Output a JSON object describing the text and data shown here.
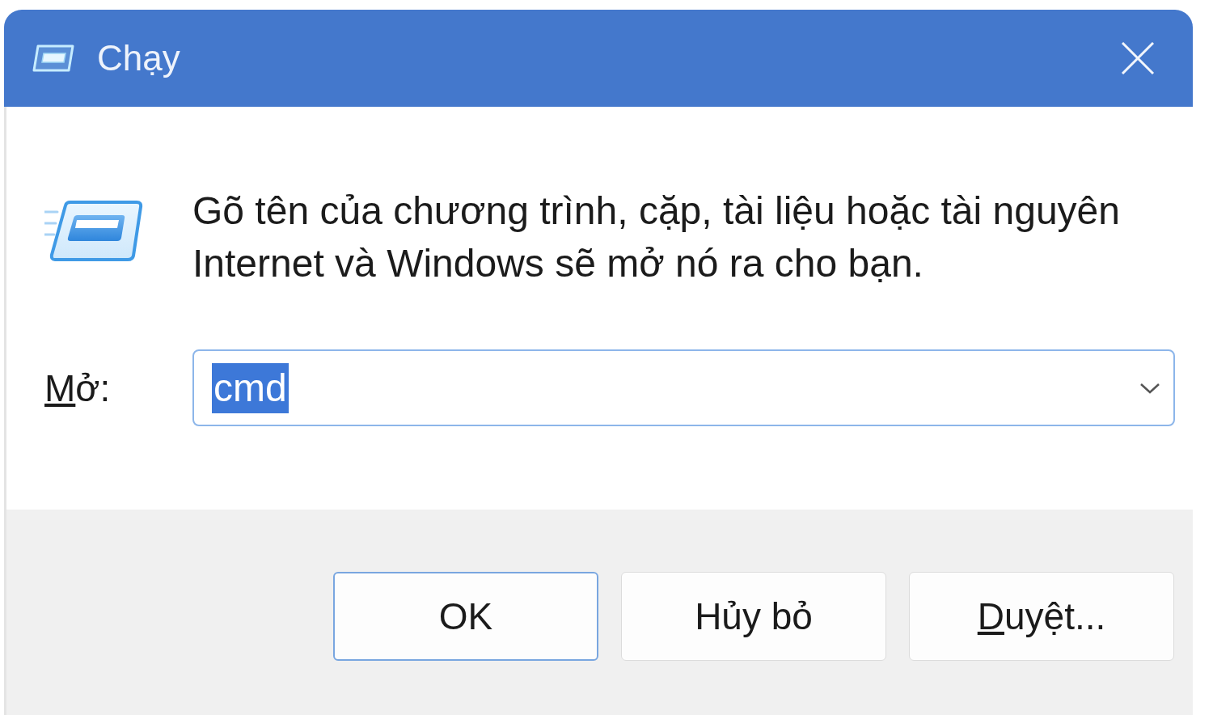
{
  "window": {
    "title": "Chạy"
  },
  "message": "Gõ tên của chương trình, cặp, tài liệu hoặc tài nguyên Internet và Windows sẽ mở nó ra cho bạn.",
  "open_field": {
    "label": "Mở:",
    "label_mnemonic": true,
    "value": "cmd",
    "value_selected": true
  },
  "buttons": [
    {
      "label": "OK",
      "default": true,
      "mnemonic": false
    },
    {
      "label": "Hủy bỏ",
      "default": false,
      "mnemonic": false
    },
    {
      "label": "Duyệt...",
      "default": false,
      "mnemonic": true
    }
  ]
}
